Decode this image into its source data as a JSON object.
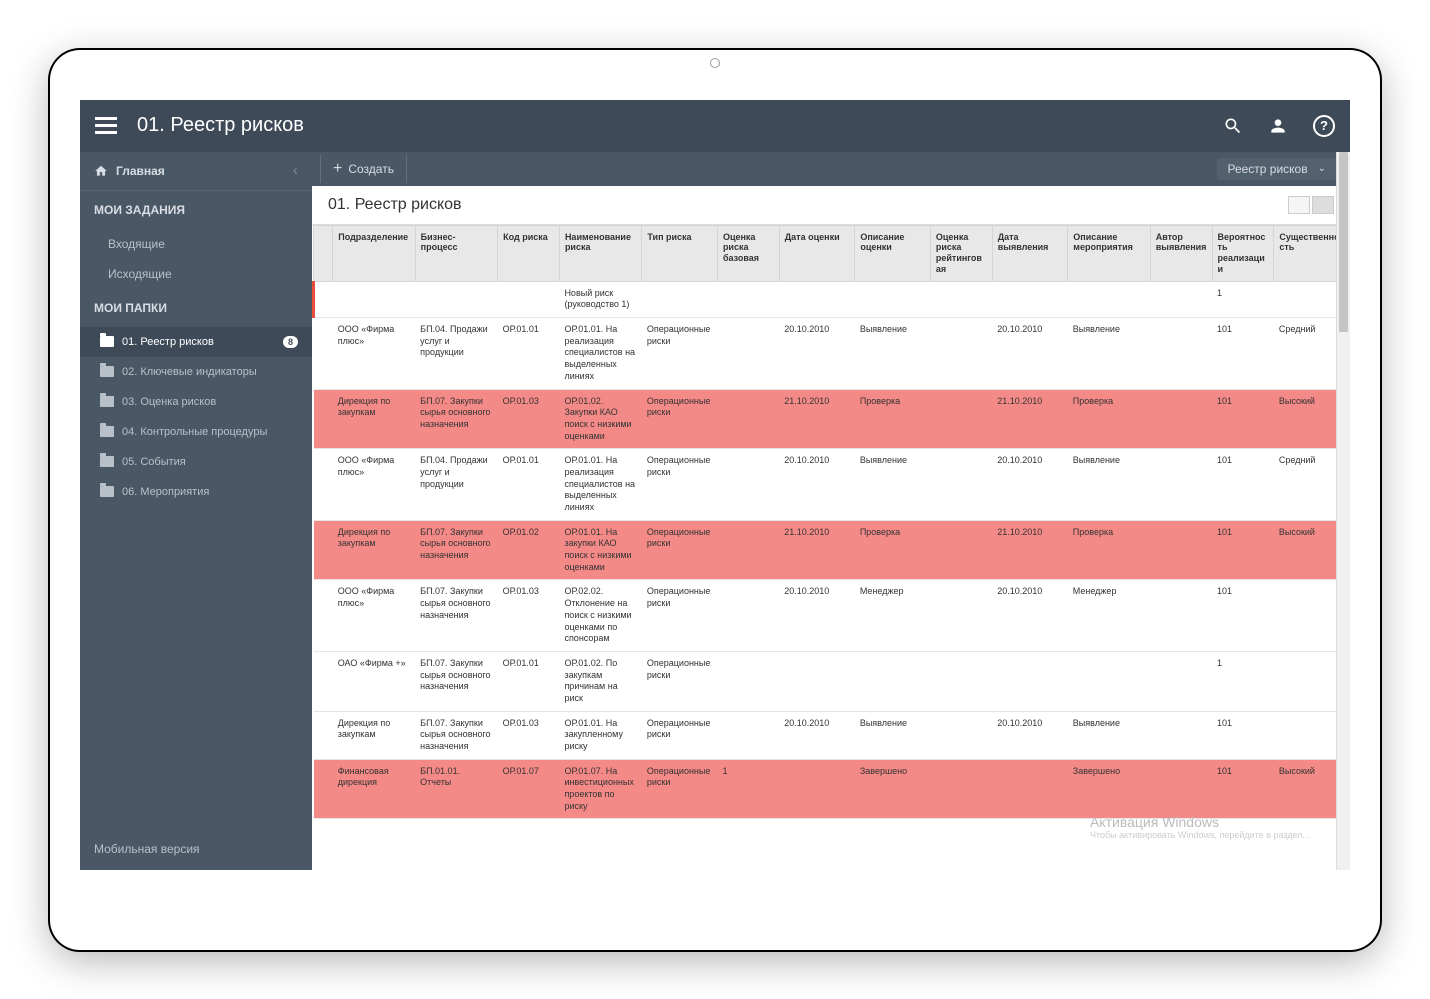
{
  "header": {
    "title": "01. Реестр рисков",
    "search": "Поиск",
    "user": "Аккаунт",
    "help": "?"
  },
  "sidebar": {
    "home": "Главная",
    "section_tasks": "МОИ ЗАДАНИЯ",
    "tasks": [
      "Входящие",
      "Исходящие"
    ],
    "section_folders": "МОИ ПАПКИ",
    "folders": [
      {
        "label": "01. Реестр рисков",
        "badge": "8",
        "active": true
      },
      {
        "label": "02. Ключевые индикаторы"
      },
      {
        "label": "03. Оценка рисков"
      },
      {
        "label": "04. Контрольные процедуры"
      },
      {
        "label": "05. События"
      },
      {
        "label": "06. Мероприятия"
      }
    ],
    "mobile": "Мобильная версия"
  },
  "toolbar": {
    "create": "Создать",
    "breadcrumb": "Реестр рисков"
  },
  "page": {
    "heading": "01. Реестр рисков"
  },
  "columns": [
    "",
    "Подразделение",
    "Бизнес-процесс",
    "Код риска",
    "Наименование риска",
    "Тип риска",
    "Оценка риска базовая",
    "Дата оценки",
    "Описание оценки",
    "Оценка риска рейтинговая",
    "Дата выявления",
    "Описание мероприятия",
    "Автор выявления",
    "Вероятность реализации",
    "Cущественность"
  ],
  "rows": [
    {
      "new": true,
      "cells": [
        "",
        "",
        "",
        "",
        "Новый риск (руководство 1)",
        "",
        "",
        "",
        "",
        "",
        "",
        "",
        "",
        "1",
        ""
      ]
    },
    {
      "cells": [
        "",
        "ООО «Фирма плюс»",
        "БП.04. Продажи услуг и продукции",
        "ОР.01.01",
        "ОР.01.01. На реализация специалистов на выделенных линиях",
        "Операционные риски",
        "",
        "20.10.2010",
        "Выявление",
        "",
        "20.10.2010",
        "Выявление",
        "",
        "101",
        "Средний"
      ]
    },
    {
      "hl": true,
      "cells": [
        "",
        "Дирекция по закупкам",
        "БП.07. Закупки сырья основного назначения",
        "ОР.01.03",
        "ОР.01.02. Закупки КАО поиск с низкими оценками",
        "Операционные риски",
        "",
        "21.10.2010",
        "Проверка",
        "",
        "21.10.2010",
        "Проверка",
        "",
        "101",
        "Высокий"
      ]
    },
    {
      "cells": [
        "",
        "ООО «Фирма плюс»",
        "БП.04. Продажи услуг и продукции",
        "ОР.01.01",
        "ОР.01.01. На реализация специалистов на выделенных линиях",
        "Операционные риски",
        "",
        "20.10.2010",
        "Выявление",
        "",
        "20.10.2010",
        "Выявление",
        "",
        "101",
        "Средний"
      ]
    },
    {
      "hl": true,
      "cells": [
        "",
        "Дирекция по закупкам",
        "БП.07. Закупки сырья основного назначения",
        "ОР.01.02",
        "ОР.01.01. На закупки КАО поиск с низкими оценками",
        "Операционные риски",
        "",
        "21.10.2010",
        "Проверка",
        "",
        "21.10.2010",
        "Проверка",
        "",
        "101",
        "Высокий"
      ]
    },
    {
      "cells": [
        "",
        "ООО «Фирма плюс»",
        "БП.07. Закупки сырья основного назначения",
        "ОР.01.03",
        "ОР.02.02. Отклонение на поиск с низкими оценками по спонсорам",
        "Операционные риски",
        "",
        "20.10.2010",
        "Менеджер",
        "",
        "20.10.2010",
        "Менеджер",
        "",
        "101",
        ""
      ]
    },
    {
      "cells": [
        "",
        "ОАО «Фирма +»",
        "БП.07. Закупки сырья основного назначения",
        "ОР.01.01",
        "ОР.01.02. По закупкам причинам на риск",
        "Операционные риски",
        "",
        "",
        "",
        "",
        "",
        "",
        "",
        "1",
        ""
      ]
    },
    {
      "cells": [
        "",
        "Дирекция по закупкам",
        "БП.07. Закупки сырья основного назначения",
        "ОР.01.03",
        "ОР.01.01. На закупленному риску",
        "Операционные риски",
        "",
        "20.10.2010",
        "Выявление",
        "",
        "20.10.2010",
        "Выявление",
        "",
        "101",
        ""
      ]
    },
    {
      "hl": true,
      "cells": [
        "",
        "Финансовая дирекция",
        "БП.01.01. Отчеты",
        "ОР.01.07",
        "ОР.01.07. На инвестиционных проектов по риску",
        "Операционные риски",
        "1",
        "",
        "Завершено",
        "",
        "",
        "Завершено",
        "",
        "101",
        "Высокий"
      ]
    }
  ],
  "watermark": {
    "line1": "Активация Windows",
    "line2": "Чтобы активировать Windows, перейдите в раздел..."
  }
}
